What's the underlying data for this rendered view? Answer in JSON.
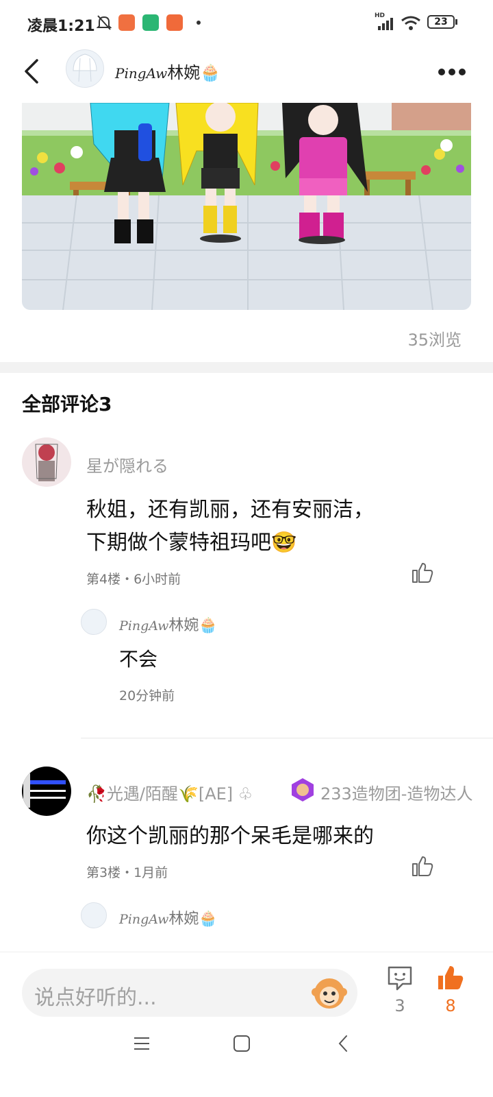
{
  "status_bar": {
    "time": "凌晨1:21",
    "network": "HD",
    "battery": "23"
  },
  "header": {
    "author_script": "PingAw",
    "author_name": "林婉🧁"
  },
  "post": {
    "views": "35浏览"
  },
  "comments_section": {
    "title": "全部评论3",
    "comments": [
      {
        "author": "星が隠れる",
        "text_line1": "秋姐，还有凯丽，还有安丽洁，",
        "text_line2": "下期做个蒙特祖玛吧🤓",
        "meta": "第4楼・6小时前",
        "reply": {
          "author_script": "PingAw",
          "author_name": "林婉🧁",
          "text": "不会",
          "time": "20分钟前"
        }
      },
      {
        "author": "🥀光遇/陌醒🌾[AE] ♧",
        "badge_text": "233造物团-造物达人",
        "text": "你这个凯丽的那个呆毛是哪来的",
        "meta": "第3楼・1月前",
        "reply": {
          "author_script": "PingAw",
          "author_name": "林婉🧁"
        }
      }
    ]
  },
  "bottom_bar": {
    "input_placeholder": "说点好听的...",
    "comment_count": "3",
    "like_count": "8"
  },
  "colors": {
    "accent": "#f07020",
    "text": "#222222",
    "secondary": "#9a9a9a"
  }
}
